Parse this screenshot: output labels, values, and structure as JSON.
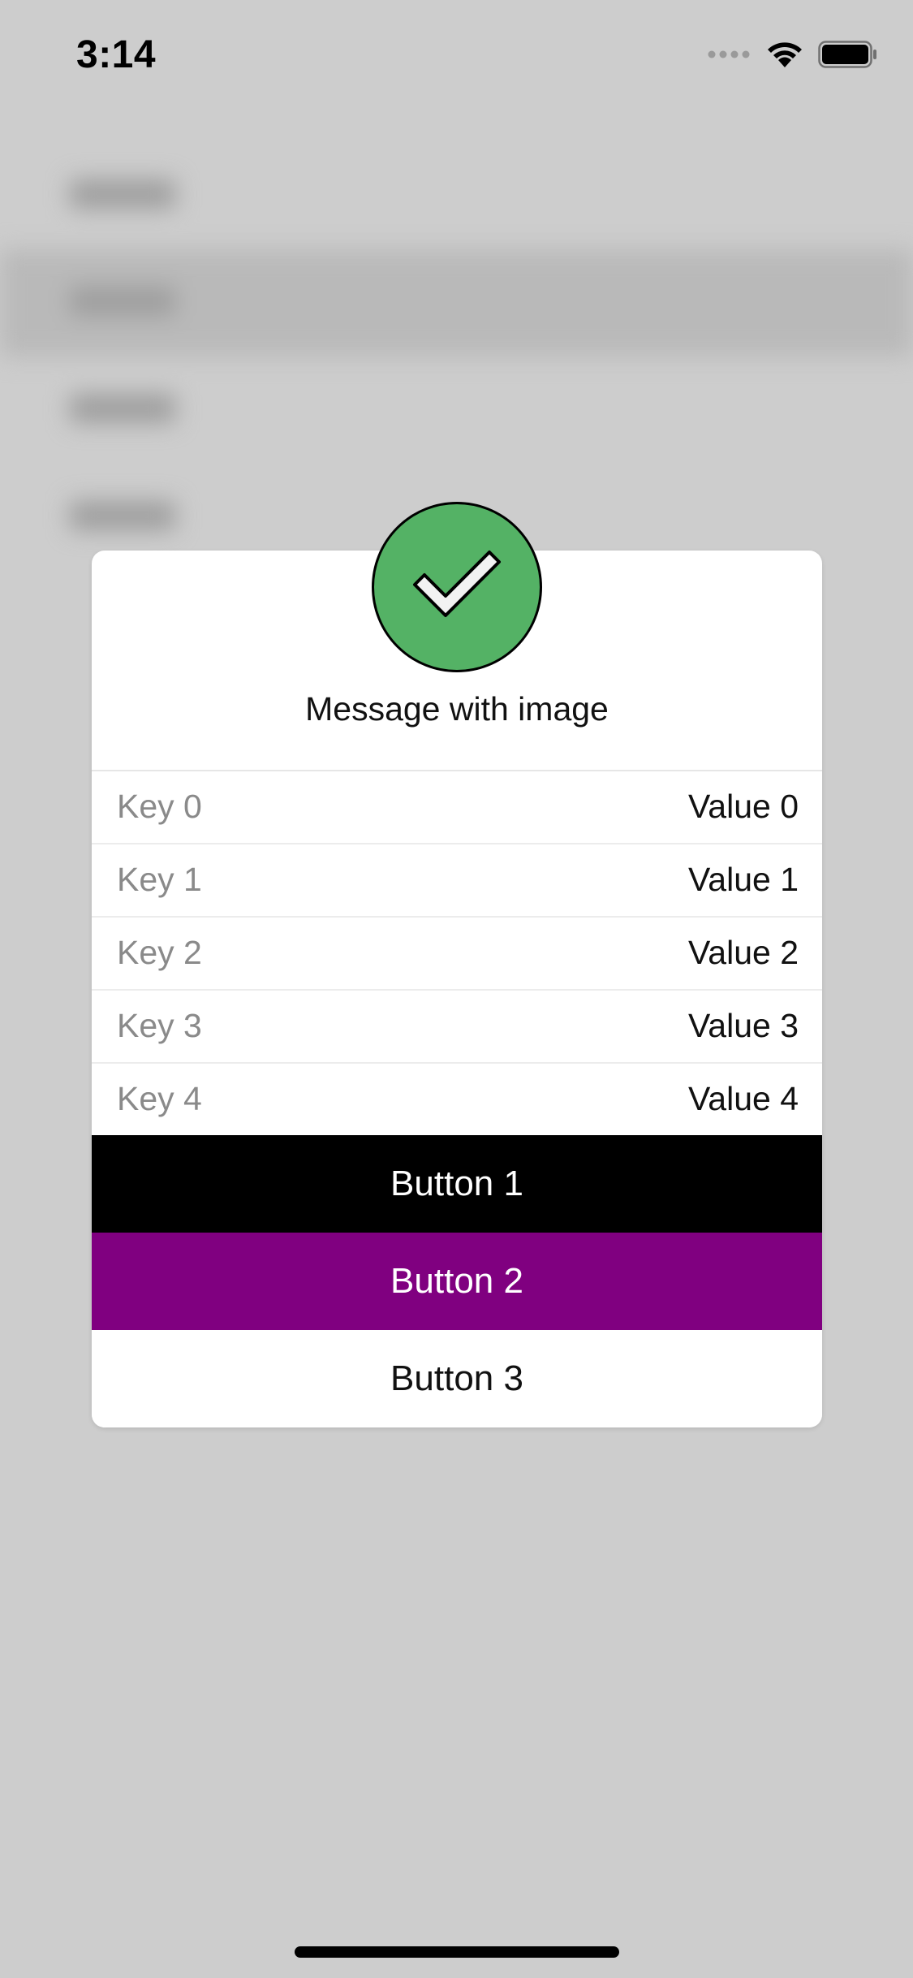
{
  "status_bar": {
    "time": "3:14",
    "signal_icon": "cellular-signal-icon",
    "wifi_icon": "wifi-icon",
    "battery_icon": "battery-icon"
  },
  "background_list": {
    "selected_index": 1,
    "rows": [
      "",
      "",
      "",
      ""
    ]
  },
  "alert": {
    "icon": "checkmark-icon",
    "icon_color": "#54b265",
    "message": "Message with image",
    "rows": [
      {
        "key": "Key 0",
        "value": "Value 0"
      },
      {
        "key": "Key 1",
        "value": "Value 1"
      },
      {
        "key": "Key 2",
        "value": "Value 2"
      },
      {
        "key": "Key 3",
        "value": "Value 3"
      },
      {
        "key": "Key 4",
        "value": "Value 4"
      }
    ],
    "buttons": [
      {
        "label": "Button 1",
        "bg": "#000000",
        "fg": "#ffffff"
      },
      {
        "label": "Button 2",
        "bg": "#800080",
        "fg": "#ffffff"
      },
      {
        "label": "Button 3",
        "bg": "#ffffff",
        "fg": "#111111"
      }
    ]
  }
}
